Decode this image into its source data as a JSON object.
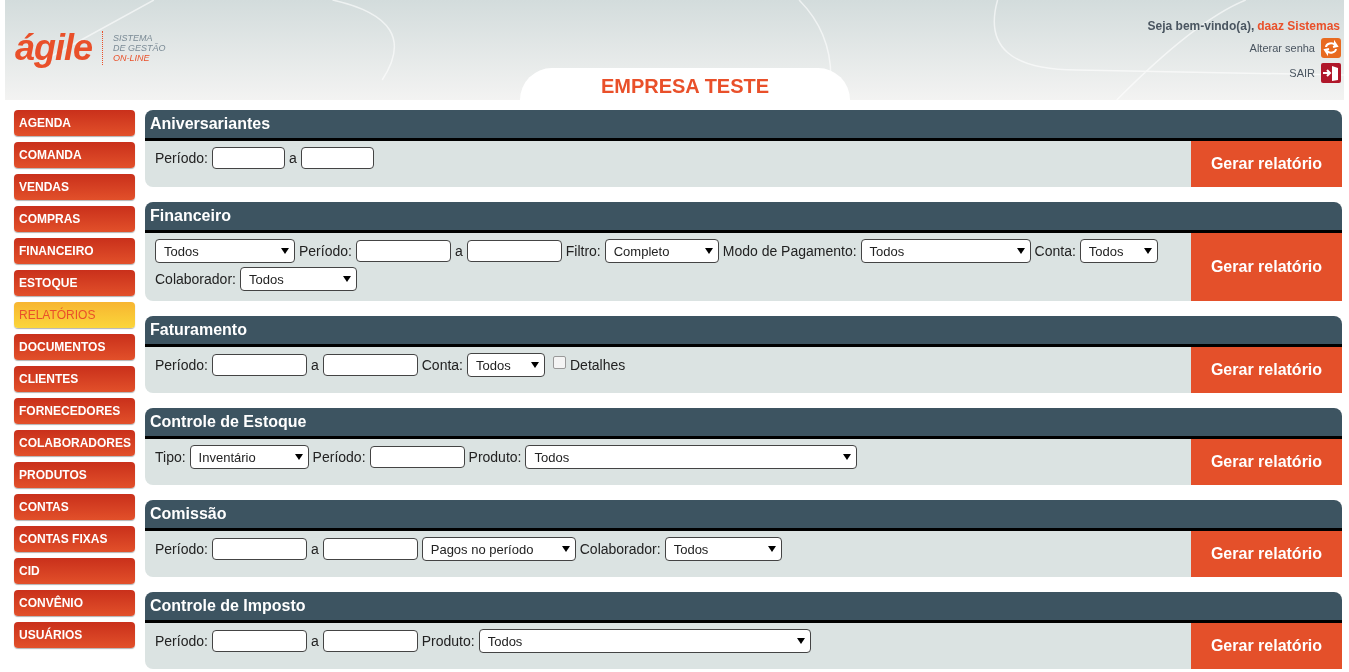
{
  "header": {
    "logo": "ágile",
    "tagline": [
      "SISTEMA",
      "DE GESTÃO",
      "ON-LINE"
    ],
    "company": "EMPRESA TESTE",
    "welcome": "Seja bem-vindo(a),",
    "user": "daaz Sistemas",
    "change_password": "Alterar senha",
    "logout": "SAIR"
  },
  "sidebar": {
    "items": [
      {
        "label": "AGENDA",
        "selected": false
      },
      {
        "label": "COMANDA",
        "selected": false
      },
      {
        "label": "VENDAS",
        "selected": false
      },
      {
        "label": "COMPRAS",
        "selected": false
      },
      {
        "label": "FINANCEIRO",
        "selected": false
      },
      {
        "label": "ESTOQUE",
        "selected": false
      },
      {
        "label": "RELATÓRIOS",
        "selected": true
      },
      {
        "label": "DOCUMENTOS",
        "selected": false
      },
      {
        "label": "CLIENTES",
        "selected": false
      },
      {
        "label": "FORNECEDORES",
        "selected": false
      },
      {
        "label": "COLABORADORES",
        "selected": false
      },
      {
        "label": "PRODUTOS",
        "selected": false
      },
      {
        "label": "CONTAS",
        "selected": false
      },
      {
        "label": "CONTAS FIXAS",
        "selected": false
      },
      {
        "label": "CID",
        "selected": false
      },
      {
        "label": "CONVÊNIO",
        "selected": false
      },
      {
        "label": "USUÁRIOS",
        "selected": false
      }
    ]
  },
  "reports": [
    {
      "title": "Aniversariantes",
      "button": "Gerar relatório",
      "controls": [
        {
          "kind": "label",
          "text": "Período:"
        },
        {
          "kind": "input"
        },
        {
          "kind": "label",
          "text": "a"
        },
        {
          "kind": "input"
        }
      ]
    },
    {
      "title": "Financeiro",
      "button": "Gerar relatório",
      "controls": [
        {
          "kind": "select",
          "value": "Todos"
        },
        {
          "kind": "label",
          "text": "Período:"
        },
        {
          "kind": "input"
        },
        {
          "kind": "label",
          "text": "a"
        },
        {
          "kind": "input"
        },
        {
          "kind": "label",
          "text": "Filtro:"
        },
        {
          "kind": "select",
          "value": "Completo"
        },
        {
          "kind": "label",
          "text": "Modo de Pagamento:"
        },
        {
          "kind": "select",
          "value": "Todos"
        },
        {
          "kind": "label",
          "text": "Conta:"
        },
        {
          "kind": "select",
          "value": "Todos"
        },
        {
          "kind": "label",
          "text": "Colaborador:"
        },
        {
          "kind": "select",
          "value": "Todos"
        }
      ]
    },
    {
      "title": "Faturamento",
      "button": "Gerar relatório",
      "controls": [
        {
          "kind": "label",
          "text": "Período:"
        },
        {
          "kind": "input"
        },
        {
          "kind": "label",
          "text": "a"
        },
        {
          "kind": "input"
        },
        {
          "kind": "label",
          "text": "Conta:"
        },
        {
          "kind": "select",
          "value": "Todos"
        },
        {
          "kind": "checkbox",
          "label": "Detalhes",
          "checked": false
        }
      ]
    },
    {
      "title": "Controle de Estoque",
      "button": "Gerar relatório",
      "controls": [
        {
          "kind": "label",
          "text": "Tipo:"
        },
        {
          "kind": "select",
          "value": "Inventário"
        },
        {
          "kind": "label",
          "text": "Período:"
        },
        {
          "kind": "input"
        },
        {
          "kind": "label",
          "text": "Produto:"
        },
        {
          "kind": "select",
          "value": "Todos"
        }
      ]
    },
    {
      "title": "Comissão",
      "button": "Gerar relatório",
      "controls": [
        {
          "kind": "label",
          "text": "Período:"
        },
        {
          "kind": "input"
        },
        {
          "kind": "label",
          "text": "a"
        },
        {
          "kind": "input"
        },
        {
          "kind": "select",
          "value": "Pagos no período"
        },
        {
          "kind": "label",
          "text": "Colaborador:"
        },
        {
          "kind": "select",
          "value": "Todos"
        }
      ]
    },
    {
      "title": "Controle de Imposto",
      "button": "Gerar relatório",
      "controls": [
        {
          "kind": "label",
          "text": "Período:"
        },
        {
          "kind": "input"
        },
        {
          "kind": "label",
          "text": "a"
        },
        {
          "kind": "input"
        },
        {
          "kind": "label",
          "text": "Produto:"
        },
        {
          "kind": "select",
          "value": "Todos"
        }
      ]
    }
  ]
}
